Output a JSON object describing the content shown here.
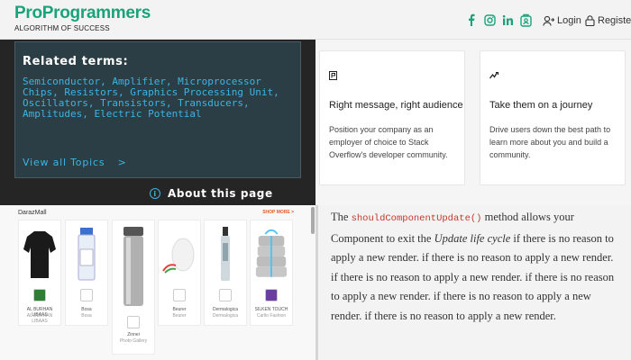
{
  "header": {
    "brand_name": "ProProgrammers",
    "brand_tagline": "ALGORITHM OF SUCCESS",
    "social_icons": [
      "facebook-icon",
      "instagram-icon",
      "linkedin-icon",
      "share-icon"
    ],
    "login_label": "Login",
    "register_label": "Register",
    "accent_color": "#1aa37a"
  },
  "related": {
    "title": "Related terms:",
    "terms": "Semiconductor, Amplifier, Microprocessor Chips, Resistors, Graphics Processing Unit, Oscillators, Transistors, Transducers, Amplitudes, Electric Potential",
    "view_all": "View all Topics",
    "view_all_arrow": ">",
    "about": "About this page",
    "link_color": "#3bb4e5"
  },
  "cards": [
    {
      "icon": "flag-icon",
      "title": "Right message, right audience",
      "body": "Position your company as an employer of choice to Stack Overflow's developer community."
    },
    {
      "icon": "pulse-icon",
      "title": "Take them on a journey",
      "body": "Drive users down the best path to learn more about you and build a community."
    }
  ],
  "products": {
    "store_name": "DarazMall",
    "shop_more": "SHOP MORE >",
    "items": [
      {
        "name": "AL BURHAN LIBAAS",
        "sub": "AL BURHAN LIBAAS"
      },
      {
        "name": "Bosa",
        "sub": "Bosa"
      },
      {
        "name": "Zinnei",
        "sub": "Photo Gallery"
      },
      {
        "name": "Beurer",
        "sub": "Beurer"
      },
      {
        "name": "Dermalogica",
        "sub": "Dermalogica"
      },
      {
        "name": "SILKEN TOUCH",
        "sub": "Carllo Fashion"
      }
    ]
  },
  "article": {
    "t1": "The ",
    "code": "shouldComponentUpdate()",
    "t2": " method allows your Component to exit the ",
    "em": "Update life cycle",
    "t3": " if there is no reason to apply a new render. if there is no reason to apply a new render. if there is no reason to apply a new render. if there is no reason to apply a new render. if there is no reason to apply a new render. if there is no reason to apply a new render."
  }
}
